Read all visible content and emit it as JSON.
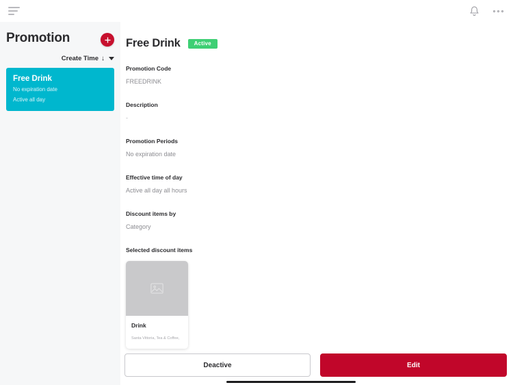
{
  "topbar": {
    "menu_icon": "hamburger-icon",
    "bell_icon": "bell-icon",
    "more_icon": "more-options-icon"
  },
  "sidebar": {
    "title": "Promotion",
    "add_button_label": "+",
    "sort": {
      "label": "Create Time",
      "direction_arrow": "↓",
      "caret_icon": "chevron-down-icon"
    },
    "promotions": [
      {
        "name": "Free Drink",
        "expiration": "No expiration date",
        "activity": "Active all day",
        "selected": true,
        "color": "#00b7ce"
      }
    ]
  },
  "detail": {
    "title": "Free Drink",
    "status": "Active",
    "status_color": "#3ecf74",
    "fields": [
      {
        "label": "Promotion Code",
        "value": "FREEDRINK"
      },
      {
        "label": "Description",
        "value": "-"
      },
      {
        "label": "Promotion Periods",
        "value": "No expiration date"
      },
      {
        "label": "Effective time of day",
        "value": "Active all day all hours"
      },
      {
        "label": "Discount items by",
        "value": "Category"
      }
    ],
    "selected_items_label": "Selected discount items",
    "items": [
      {
        "name": "Drink",
        "description": "Santa Vittoria, Tea & Coffee,",
        "image_icon": "image-placeholder-icon"
      }
    ]
  },
  "actions": {
    "secondary_label": "Deactive",
    "primary_label": "Edit",
    "primary_color": "#c1062a"
  }
}
